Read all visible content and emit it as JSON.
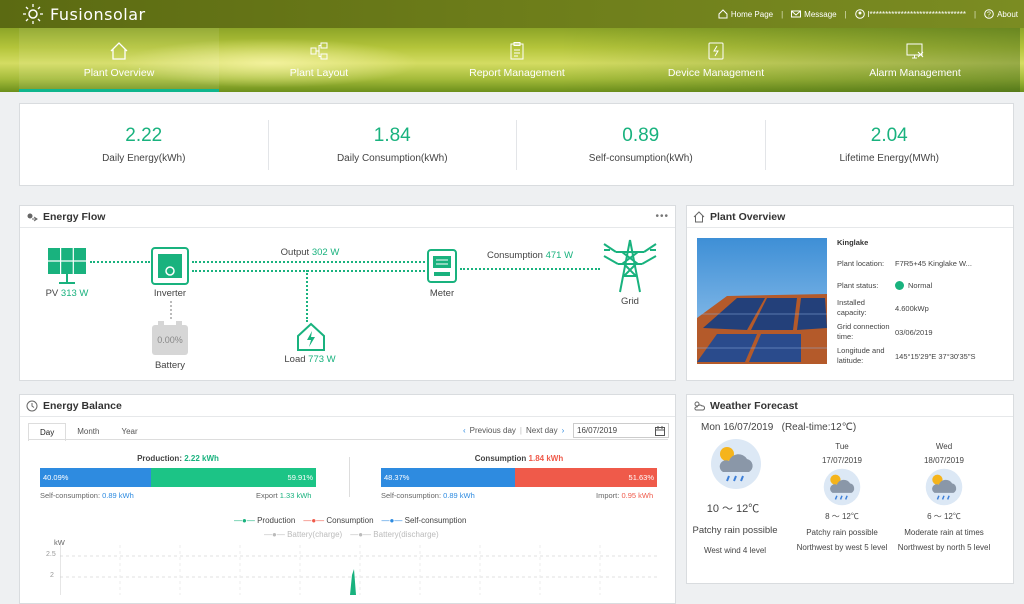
{
  "app": {
    "name": "Fusionsolar"
  },
  "topbar": {
    "home": "Home Page",
    "message": "Message",
    "user": "l*******************************",
    "about": "About"
  },
  "nav": [
    {
      "label": "Plant Overview",
      "icon": "home-icon"
    },
    {
      "label": "Plant Layout",
      "icon": "layout-icon"
    },
    {
      "label": "Report Management",
      "icon": "report-icon"
    },
    {
      "label": "Device Management",
      "icon": "device-icon"
    },
    {
      "label": "Alarm Management",
      "icon": "alarm-icon"
    }
  ],
  "kpis": [
    {
      "value": "2.22",
      "label": "Daily Energy(kWh)"
    },
    {
      "value": "1.84",
      "label": "Daily Consumption(kWh)"
    },
    {
      "value": "0.89",
      "label": "Self-consumption(kWh)"
    },
    {
      "value": "2.04",
      "label": "Lifetime Energy(MWh)"
    }
  ],
  "energy_flow": {
    "title": "Energy Flow",
    "pv_label": "PV",
    "pv_value": "313 W",
    "inverter_label": "Inverter",
    "battery_label": "Battery",
    "battery_pct": "0.00%",
    "output_label": "Output",
    "output_value": "302 W",
    "load_label": "Load",
    "load_value": "773 W",
    "meter_label": "Meter",
    "consumption_label": "Consumption",
    "consumption_value": "471 W",
    "grid_label": "Grid"
  },
  "plant_overview": {
    "title": "Plant Overview",
    "name": "Kinglake",
    "location_label": "Plant location:",
    "location_value": "F7R5+45 Kinglake W...",
    "status_label": "Plant status:",
    "status_value": "Normal",
    "capacity_label": "Installed capacity:",
    "capacity_value": "4.600kWp",
    "grid_time_label": "Grid connection time:",
    "grid_time_value": "03/06/2019",
    "lonlat_label": "Longitude and latitude:",
    "lonlat_value": "145°15'29\"E 37°30'35\"S"
  },
  "energy_balance": {
    "title": "Energy Balance",
    "tabs": [
      "Day",
      "Month",
      "Year"
    ],
    "prev_day": "Previous day",
    "next_day": "Next day",
    "date": "16/07/2019",
    "production_label": "Production:",
    "production_value": "2.22 kWh",
    "prod_self_pct": "40.09%",
    "prod_export_pct": "59.91%",
    "prod_self_text": "Self-consumption:",
    "prod_self_val": "0.89 kWh",
    "prod_export_text": "Export",
    "prod_export_val": "1.33 kWh",
    "consumption_label": "Consumption",
    "consumption_value": "1.84 kWh",
    "cons_self_pct": "48.37%",
    "cons_import_pct": "51.63%",
    "cons_self_text": "Self-consumption:",
    "cons_self_val": "0.89 kWh",
    "cons_import_text": "Import:",
    "cons_import_val": "0.95 kWh",
    "legend": [
      "Production",
      "Consumption",
      "Self-consumption",
      "Battery(charge)",
      "Battery(discharge)"
    ],
    "y_unit": "kW",
    "y_ticks": [
      "2.5",
      "2"
    ]
  },
  "weather": {
    "title": "Weather Forecast",
    "today_date": "Mon 16/07/2019",
    "realtime": "(Real-time:12℃)",
    "today_temp": "10 ～ 12℃",
    "today_desc": "Patchy rain possible",
    "today_wind": "West wind 4 level",
    "days": [
      {
        "day": "Tue",
        "date": "17/07/2019",
        "temp": "8 ～ 12℃",
        "desc": "Patchy rain possible",
        "wind": "Northwest by west 5 level"
      },
      {
        "day": "Wed",
        "date": "18/07/2019",
        "temp": "6 ～ 12℃",
        "desc": "Moderate rain at times",
        "wind": "Northwest by north 5 level"
      }
    ]
  },
  "colors": {
    "accent": "#19b27e",
    "blue": "#2e8be0",
    "red": "#ef5a4a"
  }
}
